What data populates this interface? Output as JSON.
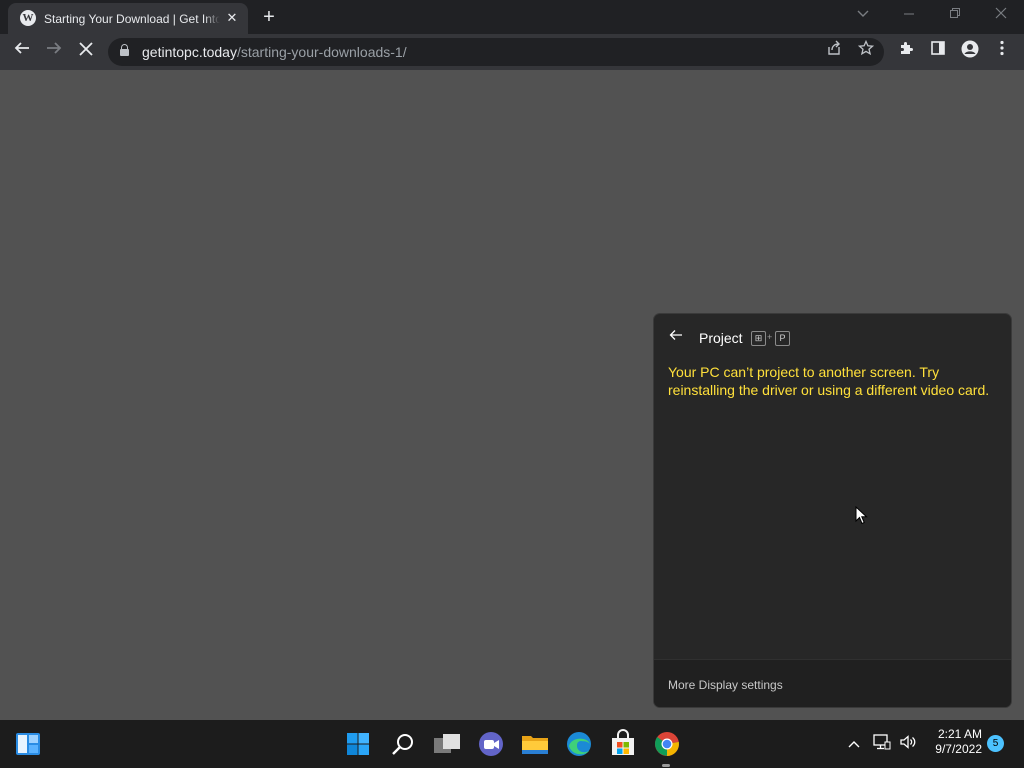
{
  "browser": {
    "tab_title": "Starting Your Download | Get Into PC",
    "tab_close": "✕",
    "new_tab": "+",
    "url_domain": "getintopc.today",
    "url_path": "/starting-your-downloads-1/"
  },
  "project_flyout": {
    "title": "Project",
    "shortcut_key1": "⊞",
    "shortcut_plus": "+",
    "shortcut_key2": "P",
    "message": "Your PC can’t project to another screen. Try reinstalling the driver or using a different video card.",
    "footer_link": "More Display settings",
    "message_color": "#ffe03b"
  },
  "taskbar": {
    "time": "2:21 AM",
    "date": "9/7/2022",
    "notification_count": "5",
    "apps": [
      "widgets-icon",
      "start-icon",
      "search-icon",
      "task-view-icon",
      "chat-icon",
      "file-explorer-icon",
      "edge-icon",
      "store-icon",
      "chrome-icon"
    ]
  },
  "colors": {
    "page_background": "#525252",
    "tabstrip": "#202124",
    "toolbar": "#35363a",
    "flyout": "#272727"
  }
}
